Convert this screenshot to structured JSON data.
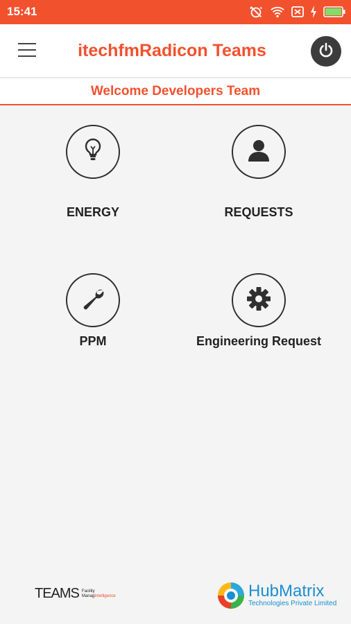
{
  "status_bar": {
    "time": "15:41",
    "icons": [
      "alarm-off-icon",
      "wifi-icon",
      "sim-off-icon",
      "charging-icon",
      "battery-icon"
    ]
  },
  "app_bar": {
    "title": "itechfmRadicon Teams",
    "menu_icon": "hamburger-menu-icon",
    "power_icon": "power-icon"
  },
  "welcome_text": "Welcome Developers Team",
  "tiles": [
    {
      "label": "ENERGY",
      "icon": "lightbulb-icon"
    },
    {
      "label": "REQUESTS",
      "icon": "person-icon"
    },
    {
      "label": "PPM",
      "icon": "wrench-icon"
    },
    {
      "label": "Engineering Request",
      "icon": "gear-icon"
    }
  ],
  "footer": {
    "teams_logo": "TEAMS",
    "teams_tagline_1": "Facility",
    "teams_tagline_2": "Manag",
    "teams_tagline_3": "Intelligence",
    "hub_name": "HubMatrix",
    "hub_sub": "Technologies Private Limited"
  },
  "colors": {
    "accent": "#f2512e",
    "icon_dark": "#2f2f2f",
    "hub_blue": "#1a8fd1",
    "background": "#f4f4f4"
  }
}
